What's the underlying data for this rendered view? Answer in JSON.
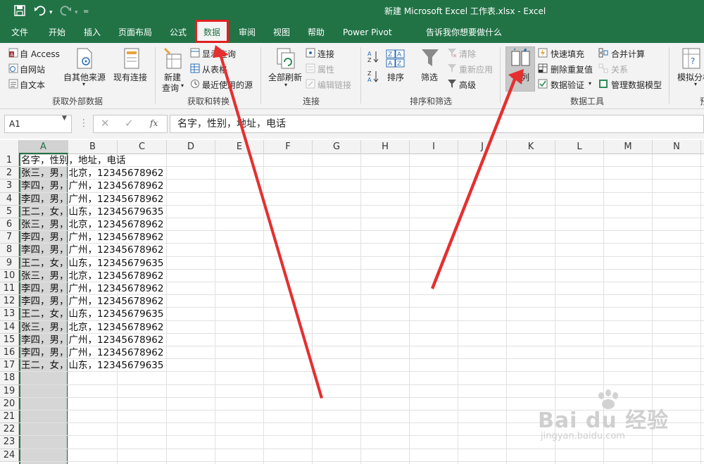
{
  "titlebar": {
    "title": "新建 Microsoft Excel 工作表.xlsx  -  Excel",
    "save_icon": "save-icon",
    "undo_icon": "undo-icon",
    "redo_icon": "redo-icon",
    "customize_icon": "customize-quick-access-icon"
  },
  "menu": {
    "tabs": [
      "文件",
      "开始",
      "插入",
      "页面布局",
      "公式",
      "数据",
      "审阅",
      "视图",
      "帮助",
      "Power Pivot"
    ],
    "active_tab": "数据",
    "tell_me": "告诉我你想要做什么"
  },
  "ribbon": {
    "get_external": {
      "access": "自 Access",
      "web": "自网站",
      "text": "自文本",
      "other": "自其他来源",
      "existing": "现有连接",
      "label": "获取外部数据"
    },
    "get_transform": {
      "new_query_l1": "新建",
      "new_query_l2": "查询",
      "show_query": "显示查询",
      "from_table": "从表格",
      "recent_sources": "最近使用的源",
      "label": "获取和转换"
    },
    "connections": {
      "refresh_all": "全部刷新",
      "connections": "连接",
      "properties": "属性",
      "edit_links": "编辑链接",
      "label": "连接"
    },
    "sort_filter": {
      "sort": "排序",
      "filter": "筛选",
      "clear": "清除",
      "reapply": "重新应用",
      "advanced": "高级",
      "label": "排序和筛选"
    },
    "data_tools": {
      "split": "分列",
      "flash_fill": "快速填充",
      "remove_dup": "删除重复值",
      "validation": "数据验证",
      "consolidate": "合并计算",
      "relations": "关系",
      "manage_model": "管理数据模型",
      "label": "数据工具"
    },
    "forecast": {
      "what_if": "模拟分析"
    }
  },
  "formula_bar": {
    "name_box": "A1",
    "fx": "fx",
    "content": "名字，性别，地址，电话"
  },
  "grid": {
    "columns": [
      "A",
      "B",
      "C",
      "D",
      "E",
      "F",
      "G",
      "H",
      "I",
      "J",
      "K",
      "L",
      "M",
      "N"
    ],
    "selected_column": "A",
    "rows": [
      "1",
      "2",
      "3",
      "4",
      "5",
      "6",
      "7",
      "8",
      "9",
      "10",
      "11",
      "12",
      "13",
      "14",
      "15",
      "16",
      "17",
      "18",
      "19",
      "20",
      "21",
      "22",
      "23",
      "24"
    ],
    "cells": [
      "名字，性别，地址，电话",
      "张三，男，北京，12345678962",
      "李四，男，广州，12345678962",
      "李四，男，广州，12345678962",
      "王二，女，山东，12345679635",
      "张三，男，北京，12345678962",
      "李四，男，广州，12345678962",
      "李四，男，广州，12345678962",
      "王二，女，山东，12345679635",
      "张三，男，北京，12345678962",
      "李四，男，广州，12345678962",
      "李四，男，广州，12345678962",
      "王二，女，山东，12345679635",
      "张三，男，北京，12345678962",
      "李四，男，广州，12345678962",
      "李四，男，广州，12345678962",
      "王二，女，山东，12345679635"
    ]
  },
  "watermark": {
    "logo": "Bai du 经验",
    "url": "jingyan.baidu.com"
  },
  "colors": {
    "excel_green": "#217346",
    "annotation_red": "#e02020"
  }
}
